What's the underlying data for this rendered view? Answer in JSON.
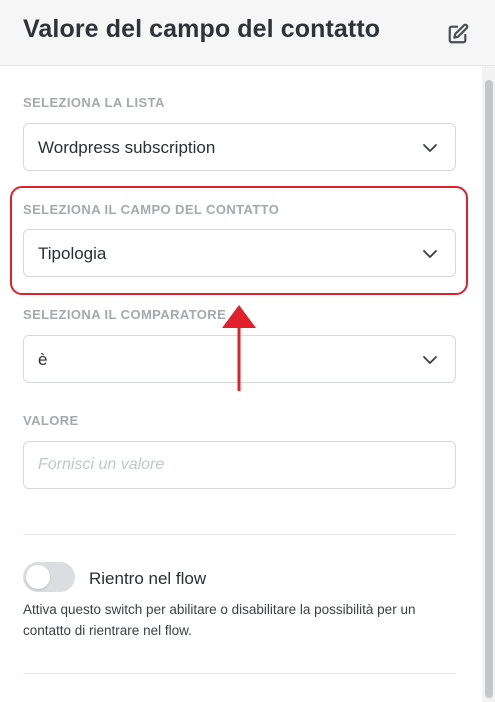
{
  "header": {
    "title": "Valore del campo del contatto",
    "edit_icon": "pencil-square-icon"
  },
  "list_field": {
    "label": "SELEZIONA LA LISTA",
    "value": "Wordpress subscription"
  },
  "contact_field": {
    "label": "SELEZIONA IL CAMPO DEL CONTATTO",
    "value": "Tipologia"
  },
  "comparator_field": {
    "label": "SELEZIONA IL COMPARATORE",
    "value": "è"
  },
  "value_field": {
    "label": "VALORE",
    "placeholder": "Fornisci un valore",
    "value": ""
  },
  "reentry": {
    "label": "Rientro nel flow",
    "enabled": false,
    "help": "Attiva questo switch per abilitare o disabilitare la possibilità per un contatto di rientrare nel flow."
  },
  "colors": {
    "highlight": "#e0202b",
    "label": "#a5a9ae",
    "border": "#d6d8db",
    "toggle_off": "#dcdde0"
  }
}
